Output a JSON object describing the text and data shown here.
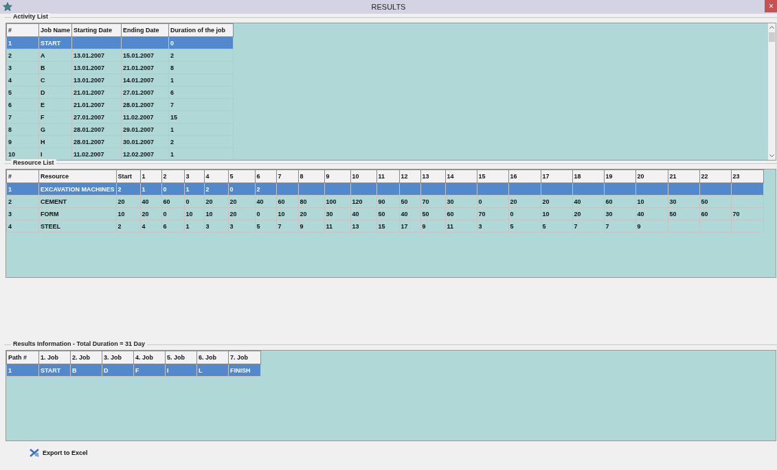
{
  "window": {
    "title": "RESULTS",
    "close": "×"
  },
  "activity_list": {
    "title": "Activity List",
    "columns": [
      "#",
      "Job Name",
      "Starting Date",
      "Ending Date",
      "Duration of the job"
    ],
    "rows": [
      {
        "cells": [
          "1",
          "START",
          "",
          "",
          "0"
        ],
        "selected": true
      },
      {
        "cells": [
          "2",
          "A",
          "13.01.2007",
          "15.01.2007",
          "2"
        ],
        "selected": false
      },
      {
        "cells": [
          "3",
          "B",
          "13.01.2007",
          "21.01.2007",
          "8"
        ],
        "selected": false
      },
      {
        "cells": [
          "4",
          "C",
          "13.01.2007",
          "14.01.2007",
          "1"
        ],
        "selected": false
      },
      {
        "cells": [
          "5",
          "D",
          "21.01.2007",
          "27.01.2007",
          "6"
        ],
        "selected": false
      },
      {
        "cells": [
          "6",
          "E",
          "21.01.2007",
          "28.01.2007",
          "7"
        ],
        "selected": false
      },
      {
        "cells": [
          "7",
          "F",
          "27.01.2007",
          "11.02.2007",
          "15"
        ],
        "selected": false
      },
      {
        "cells": [
          "8",
          "G",
          "28.01.2007",
          "29.01.2007",
          "1"
        ],
        "selected": false
      },
      {
        "cells": [
          "9",
          "H",
          "28.01.2007",
          "30.01.2007",
          "2"
        ],
        "selected": false
      },
      {
        "cells": [
          "10",
          "I",
          "11.02.2007",
          "12.02.2007",
          "1"
        ],
        "selected": false
      }
    ]
  },
  "resource_list": {
    "title": "Resource List",
    "columns": [
      "#",
      "Resource",
      "Start",
      "1",
      "2",
      "3",
      "4",
      "5",
      "6",
      "7",
      "8",
      "9",
      "10",
      "11",
      "12",
      "13",
      "14",
      "15",
      "16",
      "17",
      "18",
      "19",
      "20",
      "21",
      "22",
      "23"
    ],
    "rows": [
      {
        "cells": [
          "1",
          "EXCAVATION MACHINES",
          "2",
          "1",
          "0",
          "1",
          "2",
          "0",
          "2",
          "",
          "",
          "",
          "",
          "",
          "",
          "",
          "",
          "",
          "",
          "",
          "",
          "",
          "",
          "",
          "",
          ""
        ],
        "selected": true
      },
      {
        "cells": [
          "2",
          "CEMENT",
          "20",
          "40",
          "60",
          "0",
          "20",
          "20",
          "40",
          "60",
          "80",
          "100",
          "120",
          "90",
          "50",
          "70",
          "30",
          "0",
          "20",
          "20",
          "40",
          "60",
          "10",
          "30",
          "50",
          ""
        ],
        "selected": false
      },
      {
        "cells": [
          "3",
          "FORM",
          "10",
          "20",
          "0",
          "10",
          "10",
          "20",
          "0",
          "10",
          "20",
          "30",
          "40",
          "50",
          "40",
          "50",
          "60",
          "70",
          "0",
          "10",
          "20",
          "30",
          "40",
          "50",
          "60",
          "70"
        ],
        "selected": false
      },
      {
        "cells": [
          "4",
          "STEEL",
          "2",
          "4",
          "6",
          "1",
          "3",
          "3",
          "5",
          "7",
          "9",
          "11",
          "13",
          "15",
          "17",
          "9",
          "11",
          "3",
          "5",
          "5",
          "7",
          "7",
          "9",
          "",
          "",
          ""
        ],
        "selected": false
      }
    ]
  },
  "results": {
    "title": "Results Information - Total Duration = 31 Day",
    "columns": [
      "Path #",
      "1. Job",
      "2. Job",
      "3. Job",
      "4. Job",
      "5. Job",
      "6. Job",
      "7. Job"
    ],
    "rows": [
      {
        "cells": [
          "1",
          "START",
          "B",
          "D",
          "F",
          "I",
          "L",
          "FINISH"
        ],
        "selected": true
      }
    ]
  },
  "export_button": {
    "label": "Export to Excel"
  }
}
